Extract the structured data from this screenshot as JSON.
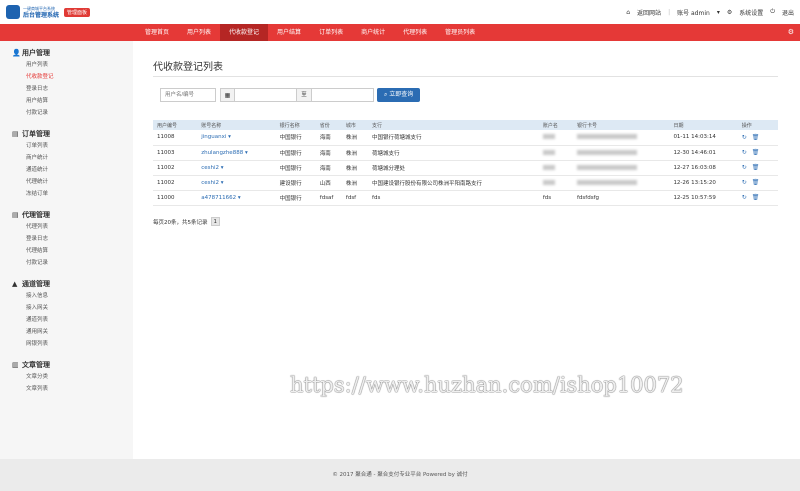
{
  "header": {
    "logo_small": "一键商城平台系统",
    "logo_main": "后台管理系统",
    "badge": "管理面板",
    "links": {
      "home": "返回网站",
      "account": "账号 admin",
      "settings": "系统设置",
      "logout": "退出"
    }
  },
  "nav": [
    "管理首页",
    "用户列表",
    "代收款登记",
    "用户结算",
    "订单列表",
    "商户统计",
    "代理列表",
    "管理员列表"
  ],
  "sidebar": [
    {
      "title": "用户管理",
      "icon": "user-icon",
      "items": [
        "用户列表",
        "代收款登记",
        "登录日志",
        "用户结算",
        "付款记录"
      ]
    },
    {
      "title": "订单管理",
      "icon": "file-icon",
      "items": [
        "订单列表",
        "商户统计",
        "通道统计",
        "代理统计",
        "冻结订单"
      ]
    },
    {
      "title": "代理管理",
      "icon": "file-icon",
      "items": [
        "代理列表",
        "登录日志",
        "代理结算",
        "付款记录"
      ]
    },
    {
      "title": "通道管理",
      "icon": "road-icon",
      "items": [
        "接入信息",
        "接入网关",
        "通道列表",
        "通用网关",
        "网银列表"
      ]
    },
    {
      "title": "文章管理",
      "icon": "book-icon",
      "items": [
        "文章分类",
        "文章列表"
      ]
    }
  ],
  "page": {
    "title": "代收款登记列表"
  },
  "filter": {
    "user_placeholder": "用户名/编号",
    "to": "至",
    "query": "立即查询"
  },
  "table": {
    "headers": [
      "用户编号",
      "账号名称",
      "银行名称",
      "省份",
      "城市",
      "支行",
      "账户名",
      "银行卡号",
      "日期",
      "操作"
    ],
    "rows": [
      [
        "11008",
        "jinguanxi",
        "中国银行",
        "海南",
        "株洲",
        "中国银行荷塘城支行",
        "",
        "",
        "01-11 14:03:14"
      ],
      [
        "11003",
        "zhulangzhe888",
        "中国银行",
        "海南",
        "株洲",
        "荷塘城支行",
        "",
        "",
        "12-30 14:46:01"
      ],
      [
        "11002",
        "ceshi2",
        "中国银行",
        "海南",
        "株洲",
        "荷塘城分理处",
        "",
        "",
        "12-27 16:03:08"
      ],
      [
        "11002",
        "ceshi2",
        "建设银行",
        "山西",
        "株洲",
        "中国建设银行股份有限公司株洲平阳南路支行",
        "",
        "",
        "12-26 13:15:20"
      ],
      [
        "11000",
        "a478711662",
        "中国银行",
        "fdsaf",
        "fdsf",
        "fds",
        "fds",
        "fdsfdsfg",
        "12-25 10:57:59"
      ]
    ]
  },
  "pager": {
    "text": "每页20条，共5条记录",
    "page": "1"
  },
  "watermark": "https://www.huzhan.com/ishop10072",
  "footer": "© 2017 聚合通 - 聚合支付专业平台 Powered by 诚付"
}
